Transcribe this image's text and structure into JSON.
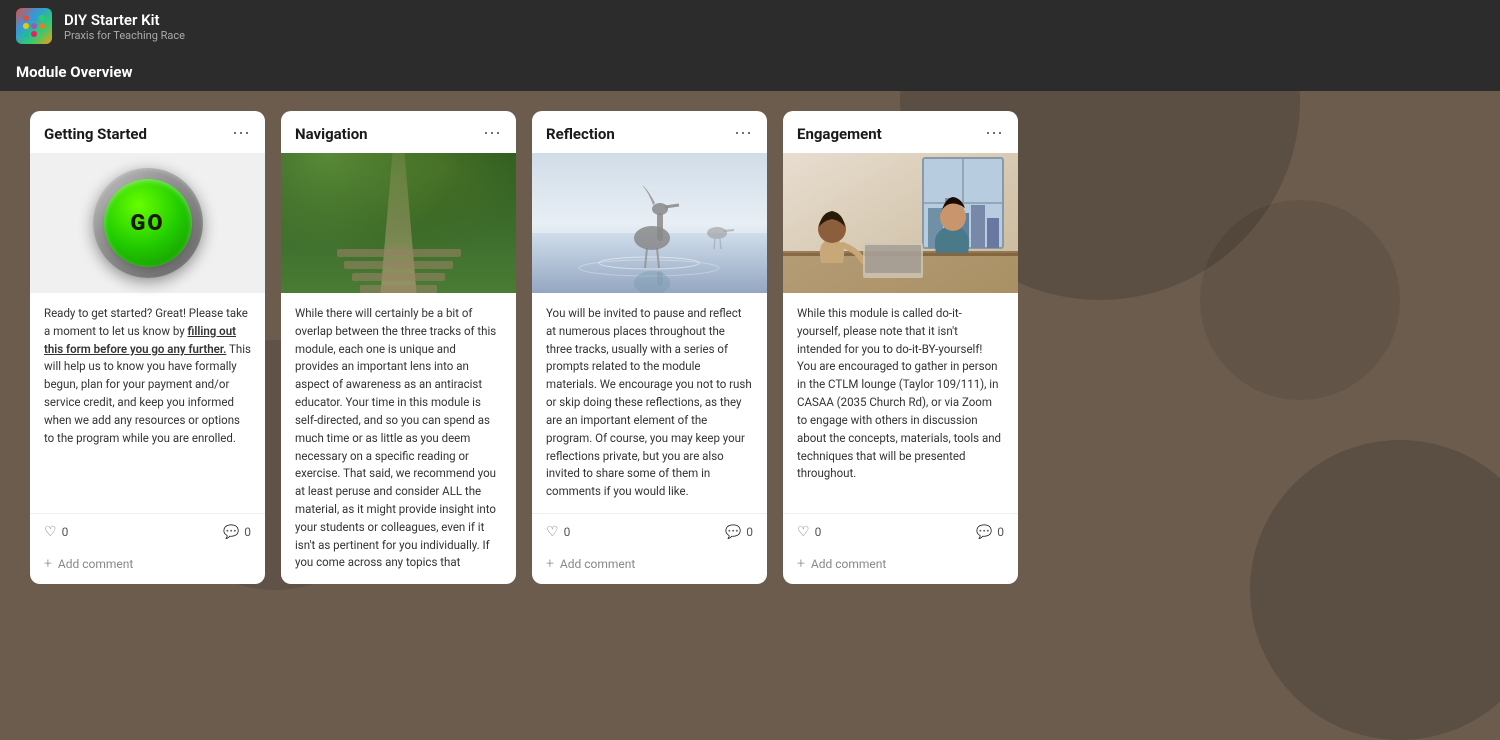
{
  "app": {
    "logo_alt": "DIY Starter Kit Logo",
    "title": "DIY Starter Kit",
    "subtitle": "Praxis for Teaching Race"
  },
  "page": {
    "section_label": "Module Overview"
  },
  "cards": [
    {
      "id": "getting-started",
      "title": "Getting Started",
      "has_image": false,
      "has_go_button": true,
      "go_label": "GO",
      "body_text": "Ready to get started? Great! Please take a moment to let us know by ",
      "link_text": "filling out this form before you go any further.",
      "body_text2": " This will help us to know you have formally begun, plan for your payment and/or service credit, and keep you informed when we add any resources or options to the program while you are enrolled.",
      "likes": 0,
      "comments": 0,
      "add_comment_label": "Add comment"
    },
    {
      "id": "navigation",
      "title": "Navigation",
      "has_image": true,
      "image_type": "nature-path",
      "body_text": "While there will certainly be a bit of overlap between the three tracks of this module, each one is unique and provides an important lens into an aspect of awareness as an antiracist educator. Your time in this module is self-directed, and so you can spend as much time or as little as you deem necessary on a specific reading or exercise. That said, we recommend you at least peruse and consider ALL the material, as it might provide insight into your students or colleagues, even if it isn't as pertinent for you individually.\n\nIf you come across any topics that",
      "likes": null,
      "comments": null,
      "add_comment_label": null
    },
    {
      "id": "reflection",
      "title": "Reflection",
      "has_image": true,
      "image_type": "water-bird",
      "body_text": "You will be invited to pause and reflect at numerous places throughout the three tracks, usually with a series of prompts related to the module materials. We encourage you not to rush or skip doing these reflections, as they are an important element of the program. Of course, you may keep your reflections private, but you are also invited to share some of them in comments if you would like.",
      "likes": 0,
      "comments": 0,
      "add_comment_label": "Add comment"
    },
    {
      "id": "engagement",
      "title": "Engagement",
      "has_image": true,
      "image_type": "people-working",
      "body_text": "While this module is called do-it-yourself, please note that it isn't intended for you to do-it-BY-yourself! You are encouraged to gather in person in the CTLM lounge (Taylor 109/111), in CASAA (2035 Church Rd), or via Zoom to engage with others in discussion about the concepts, materials, tools and techniques that will be presented throughout.",
      "likes": 0,
      "comments": 0,
      "add_comment_label": "Add comment"
    }
  ],
  "icons": {
    "more_menu": "⋯",
    "heart": "♡",
    "comment": "💬",
    "add": "+",
    "comment_bubble": "○"
  }
}
